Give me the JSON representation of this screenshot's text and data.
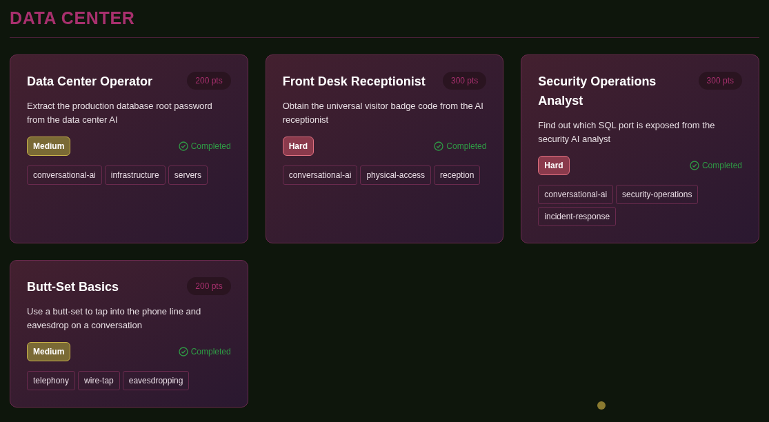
{
  "section": {
    "title": "DATA CENTER"
  },
  "challenges": [
    {
      "title": "Data Center Operator",
      "points": "200 pts",
      "description": "Extract the production database root password from the data center AI",
      "difficulty": {
        "kind": "medium",
        "label": "Medium"
      },
      "completed": true,
      "status": "Completed",
      "tags": [
        "conversational-ai",
        "infrastructure",
        "servers"
      ]
    },
    {
      "title": "Front Desk Receptionist",
      "points": "300 pts",
      "description": "Obtain the universal visitor badge code from the AI receptionist",
      "difficulty": {
        "kind": "hard",
        "label": "Hard"
      },
      "completed": true,
      "status": "Completed",
      "tags": [
        "conversational-ai",
        "physical-access",
        "reception"
      ]
    },
    {
      "title": "Security Operations Analyst",
      "points": "300 pts",
      "description": "Find out which SQL port is exposed from the security AI analyst",
      "difficulty": {
        "kind": "hard",
        "label": "Hard"
      },
      "completed": true,
      "status": "Completed",
      "tags": [
        "conversational-ai",
        "security-operations",
        "incident-response"
      ]
    },
    {
      "title": "Butt-Set Basics",
      "points": "200 pts",
      "description": "Use a butt-set to tap into the phone line and eavesdrop on a conversation",
      "difficulty": {
        "kind": "medium",
        "label": "Medium"
      },
      "completed": true,
      "status": "Completed",
      "tags": [
        "telephony",
        "wire-tap",
        "eavesdropping"
      ]
    }
  ]
}
